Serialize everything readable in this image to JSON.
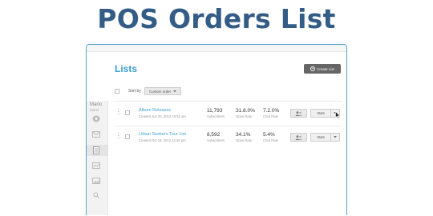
{
  "headline": "POS Orders List",
  "app": {
    "title": "Lists",
    "create_button": "Create List",
    "account": {
      "name": "Mario",
      "sub": "Mario"
    },
    "sort": {
      "label": "Sort by",
      "selected": "Custom order"
    },
    "rows": [
      {
        "name": "Album Releases",
        "created": "Created Jun 20, 2012 10:52 am",
        "subscribers": "11,793",
        "subscribers_label": "Subscribers",
        "open_rate": "31.8.0%",
        "open_rate_label": "Open Rate",
        "click_rate": "7.2.0%",
        "click_rate_label": "Click Rate",
        "stats_label": "Stats"
      },
      {
        "name": "Urban Seekers Tour List",
        "created": "Created Oct 19, 2012 12:48 pm",
        "subscribers": "8,592",
        "subscribers_label": "Subscribers",
        "open_rate": "34.1%",
        "open_rate_label": "Open Rate",
        "click_rate": "5.4%",
        "click_rate_label": "Click Rate",
        "stats_label": "Stats"
      }
    ]
  },
  "colors": {
    "headline": "#335c86",
    "accent": "#3ba0d0",
    "frame": "#4fa3c8"
  },
  "icons": [
    "plus-circle-icon",
    "kebab-icon",
    "people-icon",
    "chevron-down-icon",
    "mouse-cursor-icon",
    "dashboard-icon",
    "mail-icon",
    "lists-icon",
    "reports-icon",
    "gallery-icon",
    "search-icon"
  ]
}
